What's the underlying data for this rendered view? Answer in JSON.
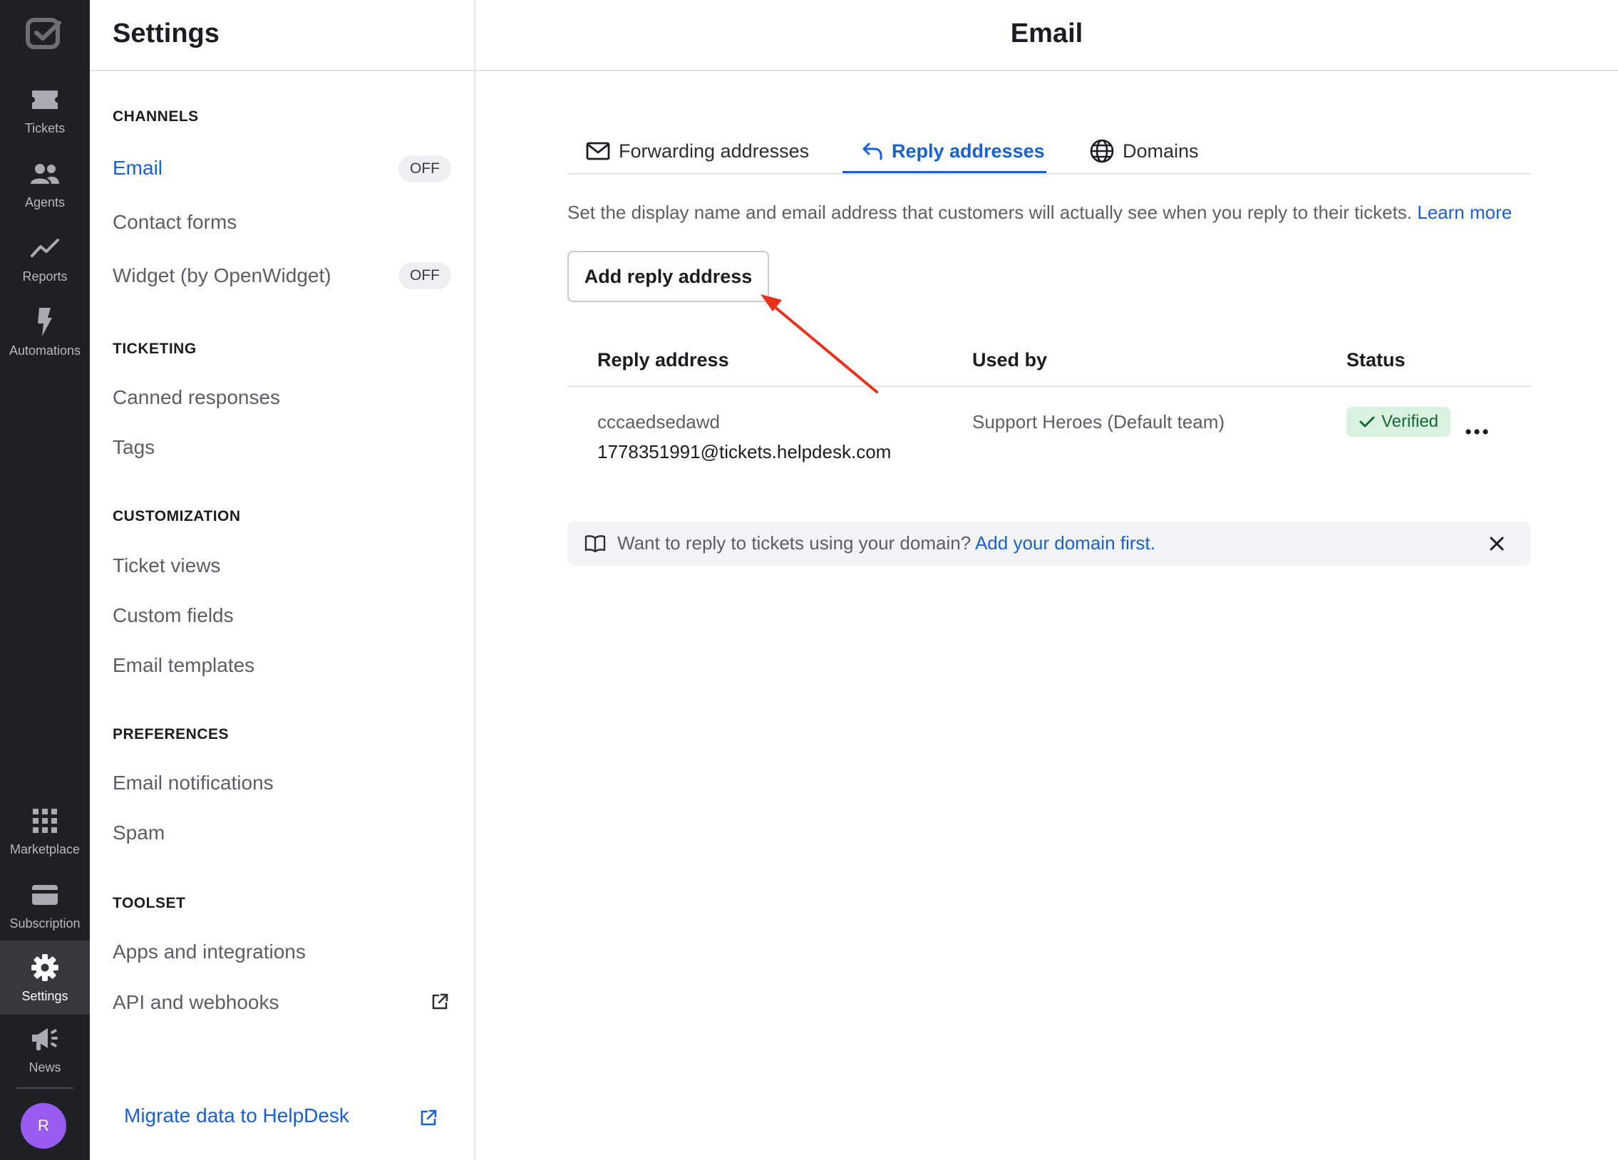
{
  "rail": {
    "items": [
      {
        "label": "Tickets"
      },
      {
        "label": "Agents"
      },
      {
        "label": "Reports"
      },
      {
        "label": "Automations"
      },
      {
        "label": "Marketplace"
      },
      {
        "label": "Subscription"
      },
      {
        "label": "Settings"
      },
      {
        "label": "News"
      }
    ],
    "active": "Settings",
    "avatar_initial": "R"
  },
  "settings": {
    "title": "Settings",
    "sections": [
      {
        "heading": "CHANNELS",
        "items": [
          {
            "label": "Email",
            "badge": "OFF",
            "active": true
          },
          {
            "label": "Contact forms"
          },
          {
            "label": "Widget (by OpenWidget)",
            "badge": "OFF"
          }
        ]
      },
      {
        "heading": "TICKETING",
        "items": [
          {
            "label": "Canned responses"
          },
          {
            "label": "Tags"
          }
        ]
      },
      {
        "heading": "CUSTOMIZATION",
        "items": [
          {
            "label": "Ticket views"
          },
          {
            "label": "Custom fields"
          },
          {
            "label": "Email templates"
          }
        ]
      },
      {
        "heading": "PREFERENCES",
        "items": [
          {
            "label": "Email notifications"
          },
          {
            "label": "Spam"
          }
        ]
      },
      {
        "heading": "TOOLSET",
        "items": [
          {
            "label": "Apps and integrations"
          },
          {
            "label": "API and webhooks",
            "icon": "external-link-icon"
          }
        ]
      }
    ],
    "migrate_link": "Migrate data to HelpDesk"
  },
  "main": {
    "title": "Email",
    "tabs": [
      {
        "label": "Forwarding addresses",
        "icon": "envelope-icon"
      },
      {
        "label": "Reply addresses",
        "icon": "reply-icon",
        "active": true
      },
      {
        "label": "Domains",
        "icon": "globe-icon"
      }
    ],
    "description": "Set the display name and email address that customers will actually see when you reply to their tickets.",
    "learn_more": "Learn more",
    "add_button": "Add reply address",
    "table": {
      "headers": [
        "Reply address",
        "Used by",
        "Status"
      ],
      "rows": [
        {
          "name": "cccaedsedawd",
          "email": "1778351991@tickets.helpdesk.com",
          "used_by": "Support Heroes (Default team)",
          "status": "Verified"
        }
      ]
    },
    "banner": {
      "text": "Want to reply to tickets using your domain?",
      "link": "Add your domain first."
    }
  },
  "colors": {
    "accent": "#1761d4",
    "rail_bg": "#1f2024",
    "verified_bg": "#d9f2df",
    "verified_text": "#146b32",
    "annotation_arrow": "#e8321c"
  }
}
